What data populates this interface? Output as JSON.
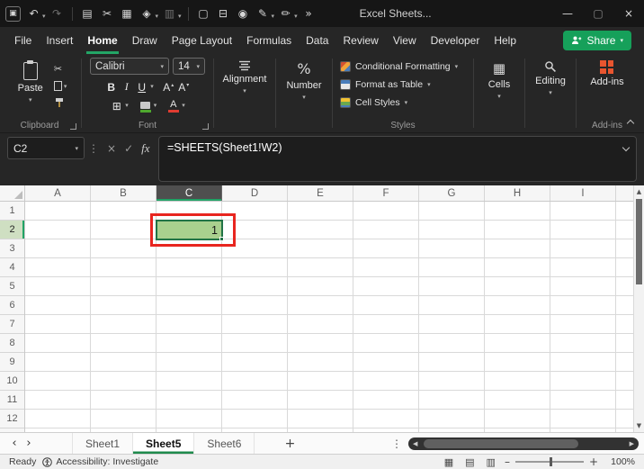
{
  "titlebar": {
    "title": "Excel Sheets..."
  },
  "icons": {
    "save": "▣",
    "undo": "↶",
    "redo": "↷",
    "dropdown": "▾",
    "clipboard": "▤",
    "cut": "✂",
    "picture": "▦",
    "shapes": "◈",
    "table": "▥",
    "new_file": "▢",
    "print": "⊟",
    "camera": "◉",
    "pen": "✎",
    "highlighter": "✏",
    "more": "»",
    "minimize": "—",
    "restore": "▢",
    "close": "×",
    "ellipsis": "⋮",
    "cancel": "×",
    "enter": "✓",
    "borders": "⊞",
    "percent": "%",
    "cells_grid": "▦",
    "grow_font": "A",
    "shrink_font": "A",
    "up_small": "▴",
    "down_small": "▾",
    "nav_left": "‹",
    "nav_right": "›",
    "scroll_left": "◀",
    "scroll_right": "▶",
    "scroll_up": "▲",
    "scroll_down": "▼",
    "add": "+",
    "view_normal": "▦",
    "view_layout": "▤",
    "view_break": "▥",
    "zoom_out": "–",
    "zoom_in": "+"
  },
  "tabs": {
    "items": [
      "File",
      "Insert",
      "Home",
      "Draw",
      "Page Layout",
      "Formulas",
      "Data",
      "Review",
      "View",
      "Developer",
      "Help"
    ],
    "active": "Home",
    "share": "Share"
  },
  "ribbon": {
    "clipboard": {
      "paste": "Paste",
      "group": "Clipboard"
    },
    "font": {
      "name": "Calibri",
      "size": "14",
      "bold": "B",
      "italic": "I",
      "underline": "U",
      "group": "Font"
    },
    "alignment": {
      "label": "Alignment"
    },
    "number": {
      "label": "Number"
    },
    "styles": {
      "items": [
        "Conditional Formatting",
        "Format as Table",
        "Cell Styles"
      ],
      "group": "Styles"
    },
    "cells": {
      "label": "Cells"
    },
    "editing": {
      "label": "Editing"
    },
    "addins": {
      "label": "Add-ins",
      "group": "Add-ins"
    }
  },
  "formula_bar": {
    "name_box": "C2",
    "fx": "fx",
    "formula": "=SHEETS(Sheet1!W2)"
  },
  "grid": {
    "columns": [
      "A",
      "B",
      "C",
      "D",
      "E",
      "F",
      "G",
      "H",
      "I"
    ],
    "rows": [
      "1",
      "2",
      "3",
      "4",
      "5",
      "6",
      "7",
      "8",
      "9",
      "10",
      "11",
      "12"
    ],
    "selected": {
      "cell": "C2",
      "value": "1",
      "fill": "#a9d08e"
    },
    "annotation_color": "#e8251f"
  },
  "sheet_tabs": {
    "items": [
      "Sheet1",
      "Sheet5",
      "Sheet6"
    ],
    "active": "Sheet5"
  },
  "status_bar": {
    "mode": "Ready",
    "accessibility": "Accessibility: Investigate",
    "zoom": "100%"
  },
  "colors": {
    "accent_green": "#21a366",
    "cell_fill": "#a9d08e",
    "annotation_red": "#e8251f",
    "share_green": "#16a05a"
  }
}
